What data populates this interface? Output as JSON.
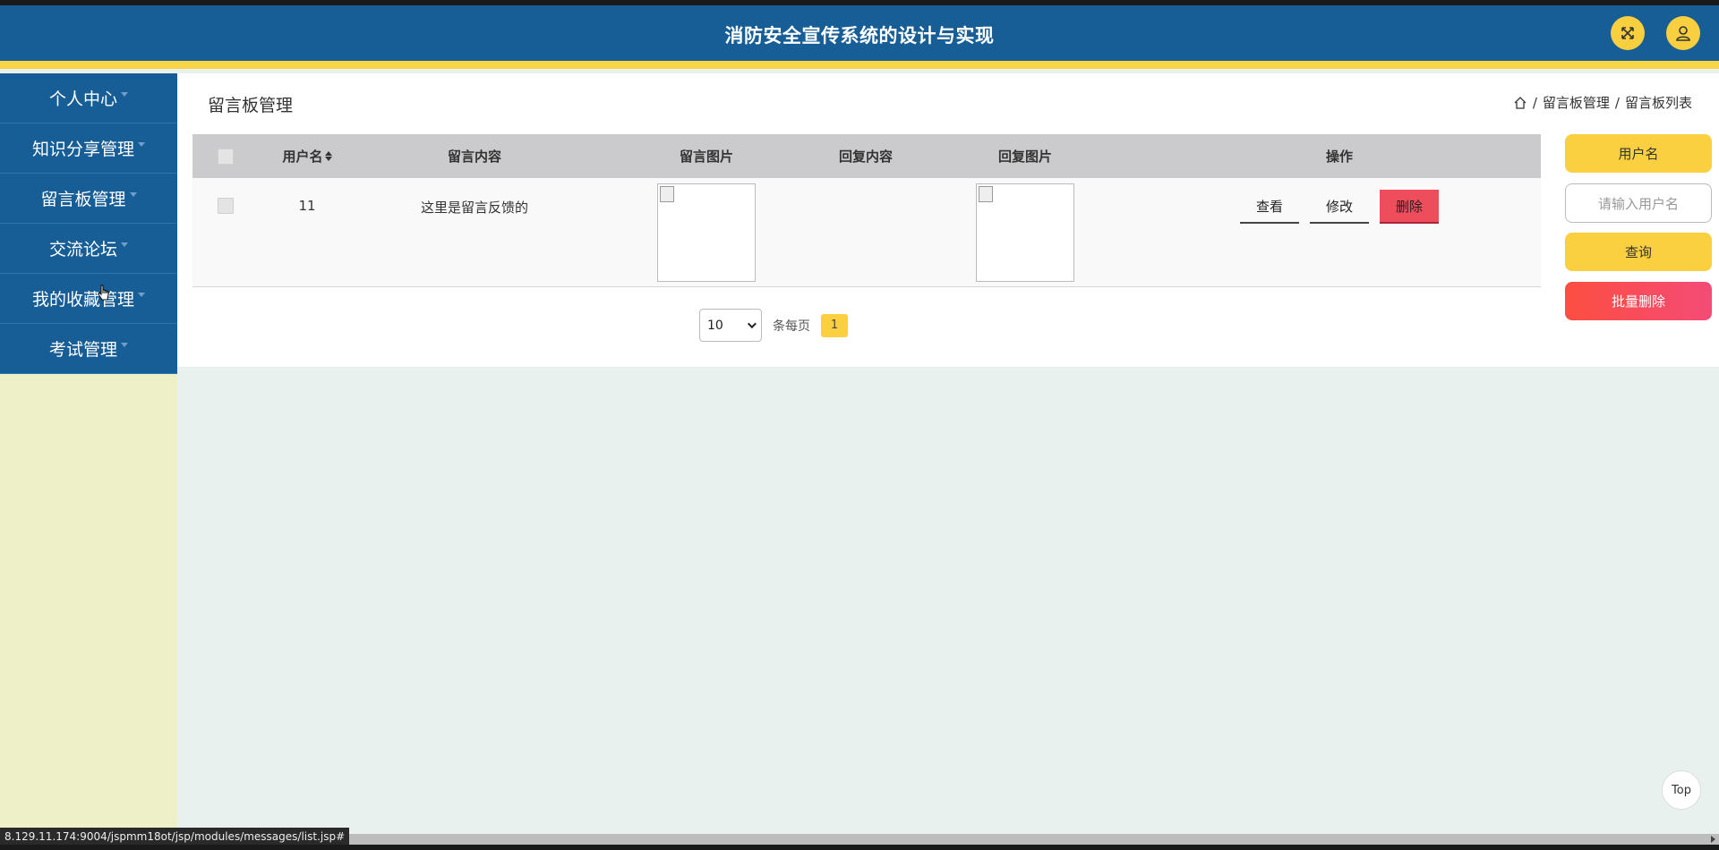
{
  "header": {
    "title": "消防安全宣传系统的设计与实现"
  },
  "sidebar": {
    "items": [
      {
        "label": "个人中心"
      },
      {
        "label": "知识分享管理"
      },
      {
        "label": "留言板管理"
      },
      {
        "label": "交流论坛"
      },
      {
        "label": "我的收藏管理"
      },
      {
        "label": "考试管理"
      }
    ]
  },
  "main": {
    "title": "留言板管理",
    "breadcrumb": {
      "level1": "留言板管理",
      "level2": "留言板列表",
      "separator": "/"
    },
    "table": {
      "headers": {
        "username": "用户名",
        "content": "留言内容",
        "image": "留言图片",
        "reply": "回复内容",
        "reply_image": "回复图片",
        "actions": "操作"
      },
      "rows": [
        {
          "username": "11",
          "content": "这里是留言反馈的",
          "reply": ""
        }
      ],
      "actions": {
        "view": "查看",
        "edit": "修改",
        "delete": "删除"
      }
    },
    "pagination": {
      "page_size": "10",
      "per_page_label": "条每页",
      "current_page": "1"
    }
  },
  "search_panel": {
    "label": "用户名",
    "input_placeholder": "请输入用户名",
    "query_label": "查询",
    "batch_delete_label": "批量删除"
  },
  "misc": {
    "top_label": "Top",
    "status_url": "8.129.11.174:9004/jspmm18ot/jsp/modules/messages/list.jsp#"
  },
  "colors": {
    "primary": "#185e96",
    "accent": "#fbd040",
    "danger": "#ee4d5c"
  }
}
